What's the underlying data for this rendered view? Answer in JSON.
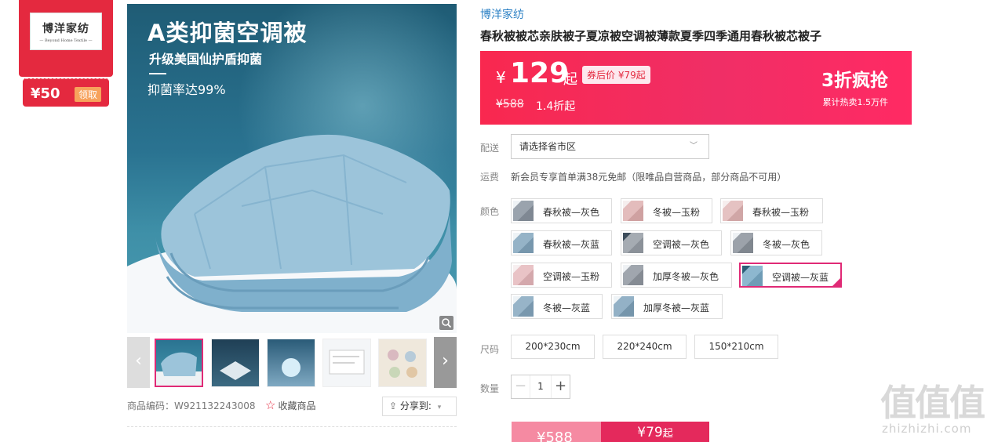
{
  "shop_badge": {
    "logo_cn": "博洋家纺",
    "logo_en": "— Beyond Home Textile —",
    "coupon_value": "¥50",
    "coupon_button": "领取"
  },
  "main_image": {
    "title": "A类抑菌空调被",
    "subtitle": "升级美国仙护盾抑菌",
    "rate": "抑菌率达99%"
  },
  "product_code": "商品编码：W921132243008",
  "favorite_label": "收藏商品",
  "share_label": "分享到:",
  "brand": "博洋家纺",
  "product_title": "春秋被被芯亲肤被子夏凉被空调被薄款夏季四季通用春秋被芯被子",
  "price": {
    "currency": "¥",
    "value": "129",
    "suffix": "起",
    "coupon_price": "券后价 ¥79起",
    "original": "¥588",
    "discount": "1.4折起",
    "promo": "3折疯抢",
    "sold": "累计热卖1.5万件"
  },
  "delivery": {
    "label": "配送",
    "placeholder": "请选择省市区"
  },
  "shipping": {
    "label": "运费",
    "text": "新会员专享首单满38元免邮（限唯品自营商品，部分商品不可用）"
  },
  "color": {
    "label": "颜色",
    "options": [
      {
        "name": "春秋被—灰色",
        "tint": "#9aa3ad"
      },
      {
        "name": "冬被—玉粉",
        "tint": "#e3bcbc"
      },
      {
        "name": "春秋被—玉粉",
        "tint": "#e5c2c2"
      },
      {
        "name": "春秋被—灰蓝",
        "tint": "#95b3c7"
      },
      {
        "name": "空调被—灰色",
        "tint": "#a5abb2"
      },
      {
        "name": "冬被—灰色",
        "tint": "#9ca2aa"
      },
      {
        "name": "空调被—玉粉",
        "tint": "#e9c3c6"
      },
      {
        "name": "加厚冬被—灰色",
        "tint": "#a0a6ae"
      },
      {
        "name": "空调被—灰蓝",
        "tint": "#8db7cf"
      },
      {
        "name": "冬被—灰蓝",
        "tint": "#97b4c8"
      },
      {
        "name": "加厚冬被—灰蓝",
        "tint": "#93b1c6"
      }
    ],
    "selected": "空调被—灰蓝"
  },
  "size": {
    "label": "尺码",
    "options": [
      "200*230cm",
      "220*240cm",
      "150*210cm"
    ]
  },
  "quantity": {
    "label": "数量",
    "value": "1",
    "minus": "−",
    "plus": "+"
  },
  "buy": {
    "left_price": "¥588",
    "right_price": "¥79",
    "right_suffix": "起"
  },
  "watermark": {
    "chars": "值值值",
    "url": "zhizhizhi.com"
  },
  "colors": {
    "accent": "#e4293f",
    "price_bg": "#f9284f",
    "selected_border": "#e02a76",
    "brand_link": "#2b80c4"
  }
}
